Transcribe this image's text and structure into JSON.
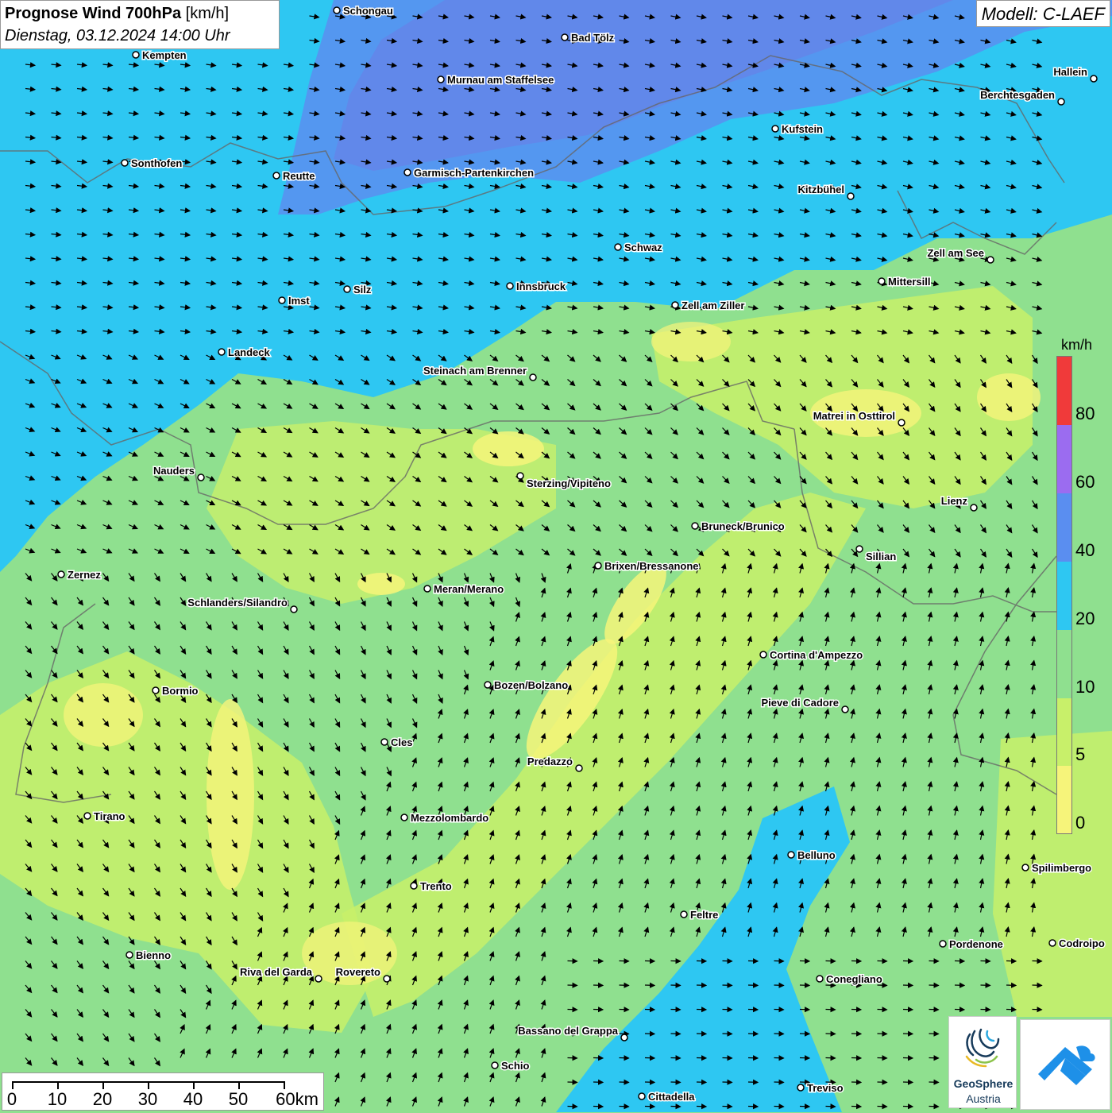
{
  "header": {
    "title_bold": "Prognose Wind 700hPa",
    "title_unit": "[km/h]",
    "datetime": "Dienstag, 03.12.2024 14:00 Uhr",
    "model": "Modell: C-LAEF"
  },
  "legend": {
    "unit": "km/h",
    "ticks": [
      "0",
      "5",
      "10",
      "20",
      "40",
      "60",
      "80"
    ],
    "colors": [
      "#f6f47a",
      "#c8f06a",
      "#8fe08f",
      "#2ec7f2",
      "#5a8ef0",
      "#9b6cf0",
      "#f03a3a"
    ]
  },
  "scalebar": {
    "labels": [
      "0",
      "10",
      "20",
      "30",
      "40",
      "50",
      "60km"
    ]
  },
  "logos": {
    "geosphere_name": "GeoSphere",
    "geosphere_sub": "Austria"
  },
  "cities": [
    "Schongau",
    "Bad Tölz",
    "Kempten",
    "Murnau am Staffelsee",
    "Hallein",
    "Berchtesgaden",
    "Kufstein",
    "Sonthofen",
    "Reutte",
    "Garmisch-Partenkirchen",
    "Kitzbühel",
    "Schwaz",
    "Zell am See",
    "Innsbruck",
    "Silz",
    "Imst",
    "Mittersill",
    "Zell am Ziller",
    "Landeck",
    "Steinach am Brenner",
    "Matrei in Osttirol",
    "Nauders",
    "Sterzing/Vipiteno",
    "Lienz",
    "Bruneck/Brunico",
    "Sillian",
    "Zernez",
    "Brixen/Bressanone",
    "Meran/Merano",
    "Schlanders/Silandro",
    "Cortina d'Ampezzo",
    "Bormio",
    "Bozen/Bolzano",
    "Pieve di Cadore",
    "Cles",
    "Predazzo",
    "Tirano",
    "Mezzolombardo",
    "Belluno",
    "Spilimbergo",
    "Trento",
    "Feltre",
    "Pordenone",
    "Codroipo",
    "Bienno",
    "Riva del Garda",
    "Rovereto",
    "Conegliano",
    "Bassano del Grappa",
    "Schio",
    "Treviso",
    "Cittadella"
  ]
}
